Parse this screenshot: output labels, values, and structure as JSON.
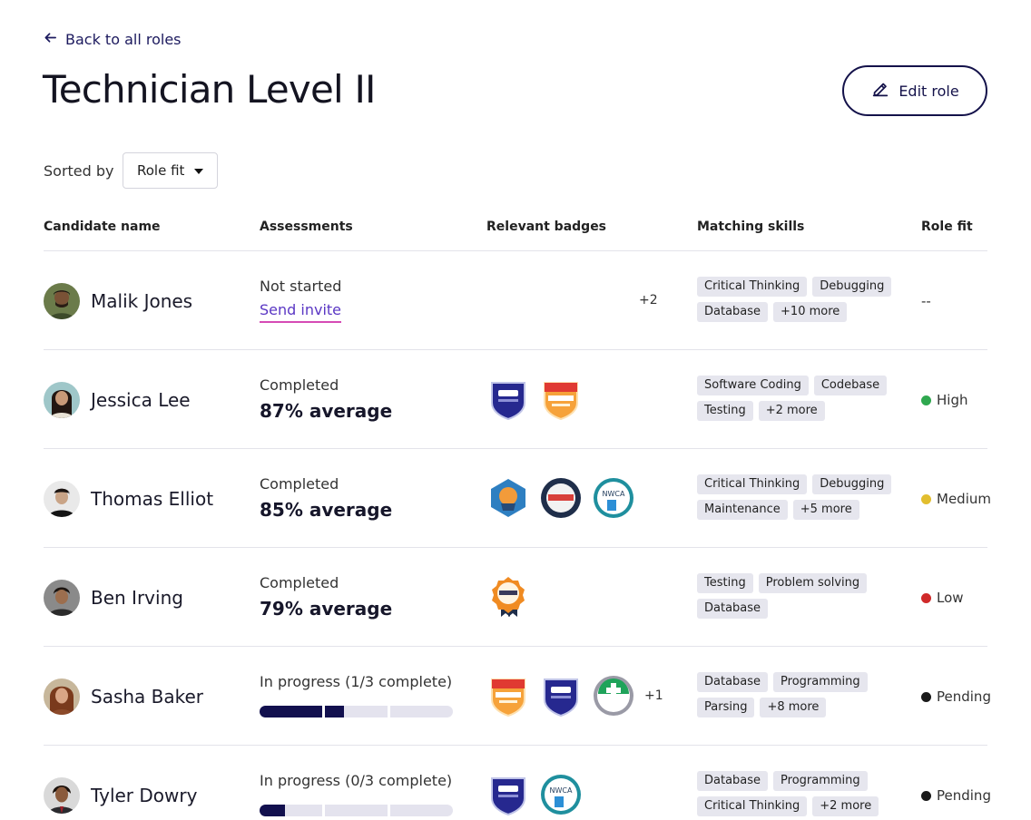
{
  "back_link": "Back to all roles",
  "title": "Technician Level II",
  "edit_button": "Edit role",
  "sort": {
    "label": "Sorted by",
    "value": "Role fit"
  },
  "columns": [
    "Candidate name",
    "Assessments",
    "Relevant badges",
    "Matching skills",
    "Role fit"
  ],
  "candidates": [
    {
      "name": "Malik Jones",
      "status": "Not started",
      "action": "Send invite",
      "badge_extra": "+2",
      "skills": [
        "Critical Thinking",
        "Debugging",
        "Database",
        "+10 more"
      ],
      "fit": "--"
    },
    {
      "name": "Jessica Lee",
      "status": "Completed",
      "score": "87% average",
      "skills": [
        "Software Coding",
        "Codebase",
        "Testing",
        "+2 more"
      ],
      "fit": "High",
      "fit_color": "#2fa84f"
    },
    {
      "name": "Thomas Elliot",
      "status": "Completed",
      "score": "85% average",
      "skills": [
        "Critical Thinking",
        "Debugging",
        "Maintenance",
        "+5 more"
      ],
      "fit": "Medium",
      "fit_color": "#e2be2f"
    },
    {
      "name": "Ben Irving",
      "status": "Completed",
      "score": "79% average",
      "skills": [
        "Testing",
        "Problem solving",
        "Database"
      ],
      "fit": "Low",
      "fit_color": "#d02a2a"
    },
    {
      "name": "Sasha Baker",
      "status": "In progress (1/3 complete)",
      "progress": [
        1,
        0.3,
        0
      ],
      "badge_extra": "+1",
      "skills": [
        "Database",
        "Programming",
        "Parsing",
        "+8 more"
      ],
      "fit": "Pending",
      "fit_color": "#1a1a1a"
    },
    {
      "name": "Tyler Dowry",
      "status": "In progress (0/3 complete)",
      "progress": [
        0.4,
        0,
        0
      ],
      "skills": [
        "Database",
        "Programming",
        "Critical Thinking",
        "+2 more"
      ],
      "fit": "Pending",
      "fit_color": "#1a1a1a"
    }
  ],
  "icons": {
    "back": "arrow-left-icon",
    "edit": "pencil-icon",
    "sort": "caret-down-icon"
  }
}
